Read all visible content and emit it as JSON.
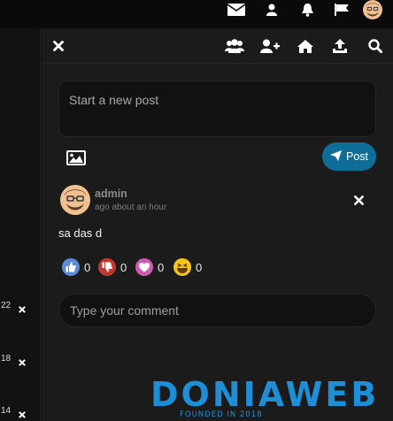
{
  "topbar": {
    "icons": [
      "envelope-icon",
      "user-icon",
      "bell-icon",
      "flag-icon",
      "avatar"
    ]
  },
  "left_column": {
    "items": [
      {
        "count": "22"
      },
      {
        "count": "18"
      },
      {
        "count": "14"
      }
    ]
  },
  "panel_header": {
    "icons": [
      "close-icon",
      "users-icon",
      "add-user-icon",
      "home-icon",
      "upload-icon",
      "search-icon"
    ]
  },
  "composer": {
    "placeholder": "Start a new post",
    "post_label": "Post"
  },
  "post": {
    "author": "admin",
    "time": "ago about an hour",
    "text": "sa das d",
    "reactions": [
      {
        "icon": "like-icon",
        "count": "0",
        "color": "#5a8bd6"
      },
      {
        "icon": "dislike-icon",
        "count": "0",
        "color": "#c0392b"
      },
      {
        "icon": "love-icon",
        "count": "0",
        "color": "#d05ab0"
      },
      {
        "icon": "laugh-icon",
        "count": "0",
        "color": "#f5c518"
      }
    ]
  },
  "comment": {
    "placeholder": "Type your comment"
  },
  "watermark": {
    "brand": "DONIAWEB",
    "tagline": "FOUNDED IN 2018"
  },
  "colors": {
    "accent": "#0f6e97",
    "panel": "#1b1b1b",
    "background": "#101010"
  }
}
